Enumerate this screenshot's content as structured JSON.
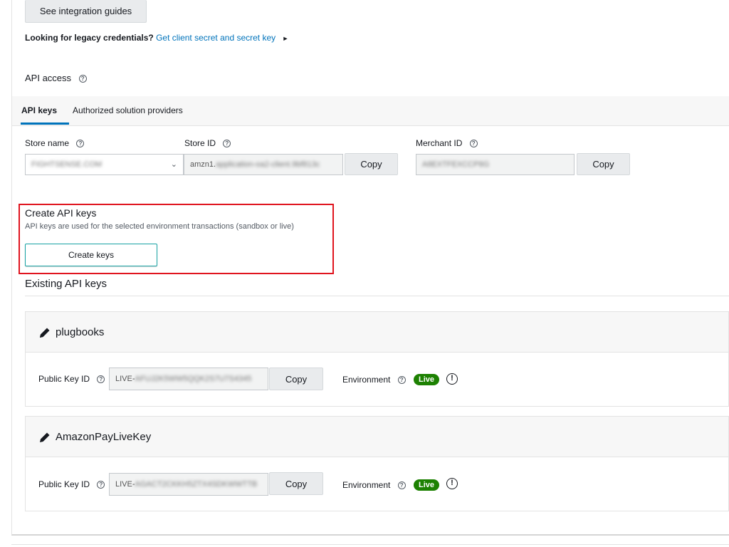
{
  "top": {
    "integration_button": "See integration guides",
    "legacy_question": "Looking for legacy credentials?",
    "legacy_link": "Get client secret and secret key",
    "legacy_arrow": "►",
    "api_access_label": "API access"
  },
  "tabs": [
    {
      "label": "API keys",
      "active": true
    },
    {
      "label": "Authorized solution providers",
      "active": false
    }
  ],
  "fields": {
    "store_name_label": "Store name",
    "store_name_value": "FIGHTSENSE.COM",
    "store_id_label": "Store ID",
    "store_id_prefix": "amzn1.",
    "store_id_value": "application-oa2-client.9bf813c",
    "merchant_id_label": "Merchant ID",
    "merchant_id_value": "A8EXTFEXCCP8G",
    "copy_label": "Copy"
  },
  "create": {
    "title": "Create API keys",
    "description": "API keys are used for the selected environment transactions (sandbox or live)",
    "button": "Create keys"
  },
  "existing": {
    "title": "Existing API keys",
    "keys": [
      {
        "name": "plugbooks",
        "public_key_label": "Public Key ID",
        "public_key_prefix": "LIVE-",
        "public_key_value": "AFUJ2K5WW5QQK2S7U7S4345",
        "copy_label": "Copy",
        "environment_label": "Environment",
        "environment_value": "Live"
      },
      {
        "name": "AmazonPayLiveKey",
        "public_key_label": "Public Key ID",
        "public_key_prefix": "LIVE-",
        "public_key_value": "AGACT2CKKH5ZTX4SDKWWTTB",
        "copy_label": "Copy",
        "environment_label": "Environment",
        "environment_value": "Live"
      }
    ]
  },
  "icons": {
    "help": "?",
    "info": "!",
    "chevron": "⌄"
  },
  "colors": {
    "link": "#0073bb",
    "live_badge": "#1d8102",
    "highlight_box": "#e0141e",
    "create_button_border": "#16a2a3"
  }
}
